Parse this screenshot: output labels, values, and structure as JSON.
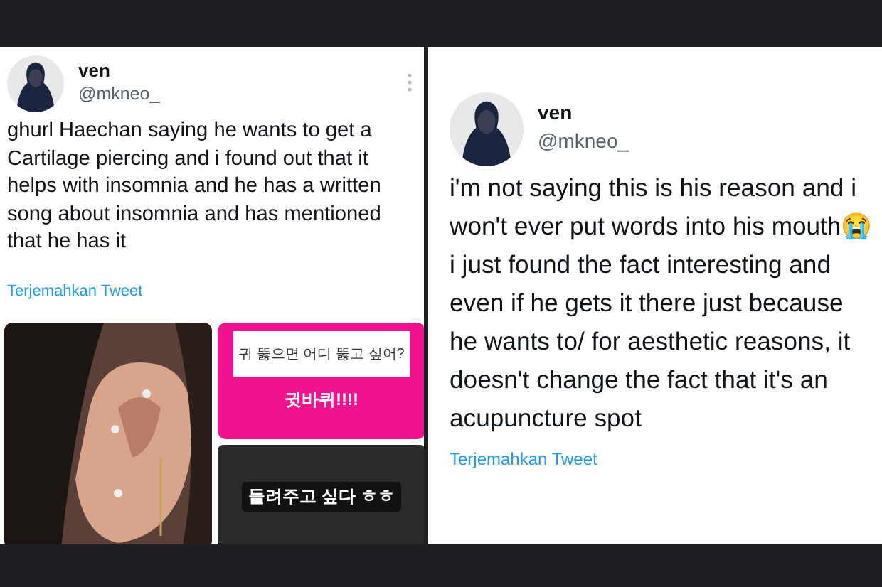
{
  "tweets": [
    {
      "name": "ven",
      "handle": "@mkneo_",
      "text": "ghurl Haechan saying he wants to get a Cartilage piercing and i found out that it helps with insomnia and he has a written song about insomnia and has mentioned that he has it",
      "translate": "Terjemahkan Tweet",
      "media": [
        {
          "kind": "picture"
        },
        {
          "kind": "story",
          "question": "귀 뚫으면 어디 뚫고 싶어?",
          "answer": "귓바퀴!!!!"
        },
        {
          "kind": "video",
          "caption": "들려주고 싶다 ㅎㅎ"
        }
      ]
    },
    {
      "name": "ven",
      "handle": "@mkneo_",
      "text": "i'm not saying this is his reason and i won't ever put words into his mouth😭 i just found the fact interesting and even if he gets it there just because he wants to/ for aesthetic reasons, it doesn't change the fact that it's an acupuncture spot",
      "translate": "Terjemahkan Tweet"
    }
  ]
}
